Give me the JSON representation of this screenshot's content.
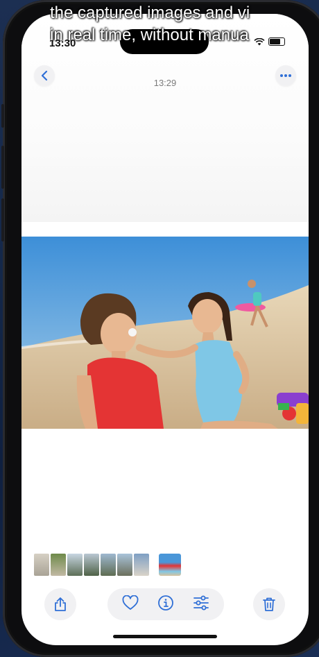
{
  "caption": {
    "line1": "the captured images and vi",
    "line2": "in real time, without manua"
  },
  "status_bar": {
    "time": "13:30"
  },
  "nav": {
    "time": "13:29",
    "back_icon": "chevron-left-icon",
    "more_icon": "ellipsis-icon"
  },
  "toolbar": {
    "share_icon": "share-icon",
    "favorite_icon": "heart-icon",
    "info_icon": "info-icon",
    "adjust_icon": "sliders-icon",
    "delete_icon": "trash-icon"
  },
  "colors": {
    "accent": "#2f6fd6",
    "toolbar_bg": "#f1f1f3"
  }
}
